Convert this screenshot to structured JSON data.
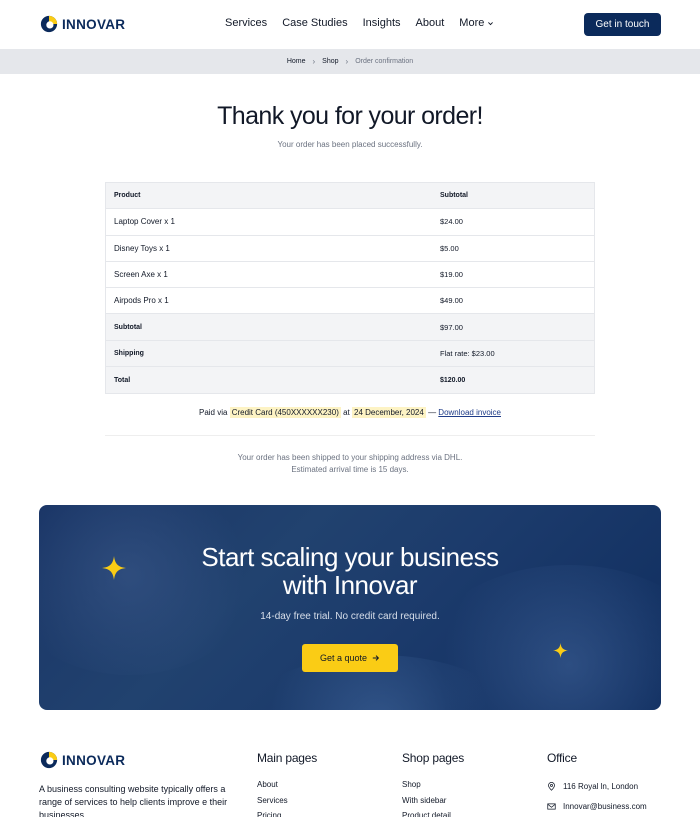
{
  "brand": {
    "name": "INNOVAR",
    "accent": "#0b2a5b",
    "highlight": "#facc15"
  },
  "nav": {
    "items": [
      "Services",
      "Case Studies",
      "Insights",
      "About",
      "More"
    ],
    "cta": "Get in touch"
  },
  "breadcrumb": {
    "items": [
      "Home",
      "Shop",
      "Order confirmation"
    ]
  },
  "confirmation": {
    "title": "Thank you for your order!",
    "subtitle": "Your order has been placed successfully."
  },
  "order": {
    "headers": [
      "Product",
      "Subtotal"
    ],
    "items": [
      {
        "product": "Laptop Cover x 1",
        "subtotal": "$24.00"
      },
      {
        "product": "Disney Toys x 1",
        "subtotal": "$5.00"
      },
      {
        "product": "Screen Axe x 1",
        "subtotal": "$19.00"
      },
      {
        "product": "Airpods Pro x 1",
        "subtotal": "$49.00"
      }
    ],
    "summary": [
      {
        "label": "Subtotal",
        "value": "$97.00"
      },
      {
        "label": "Shipping",
        "value": "Flat rate: $23.00"
      },
      {
        "label": "Total",
        "value": "$120.00"
      }
    ]
  },
  "payment": {
    "prefix": "Paid via",
    "method": "Credit Card (450XXXXXX230)",
    "at": "at",
    "date": "24 December, 2024",
    "dash": "—",
    "invoice_link": "Download invoice"
  },
  "shipping_note": {
    "line1": "Your order has been shipped to your shipping address via DHL.",
    "line2": "Estimated arrival time is 15 days."
  },
  "banner": {
    "title_line1": "Start scaling your business",
    "title_line2": "with Innovar",
    "subtitle": "14-day free trial. No credit card required.",
    "button": "Get a quote"
  },
  "footer": {
    "brand": "INNOVAR",
    "description": "A business consulting website typically offers a range of services to help clients improve e their businesses",
    "main_pages": {
      "title": "Main pages",
      "links": [
        "About",
        "Services",
        "Pricing"
      ]
    },
    "shop_pages": {
      "title": "Shop pages",
      "links": [
        "Shop",
        "With sidebar",
        "Product detail"
      ]
    },
    "office": {
      "title": "Office",
      "address": "116 Royal ln, London",
      "email": "Innovar@business.com"
    }
  }
}
